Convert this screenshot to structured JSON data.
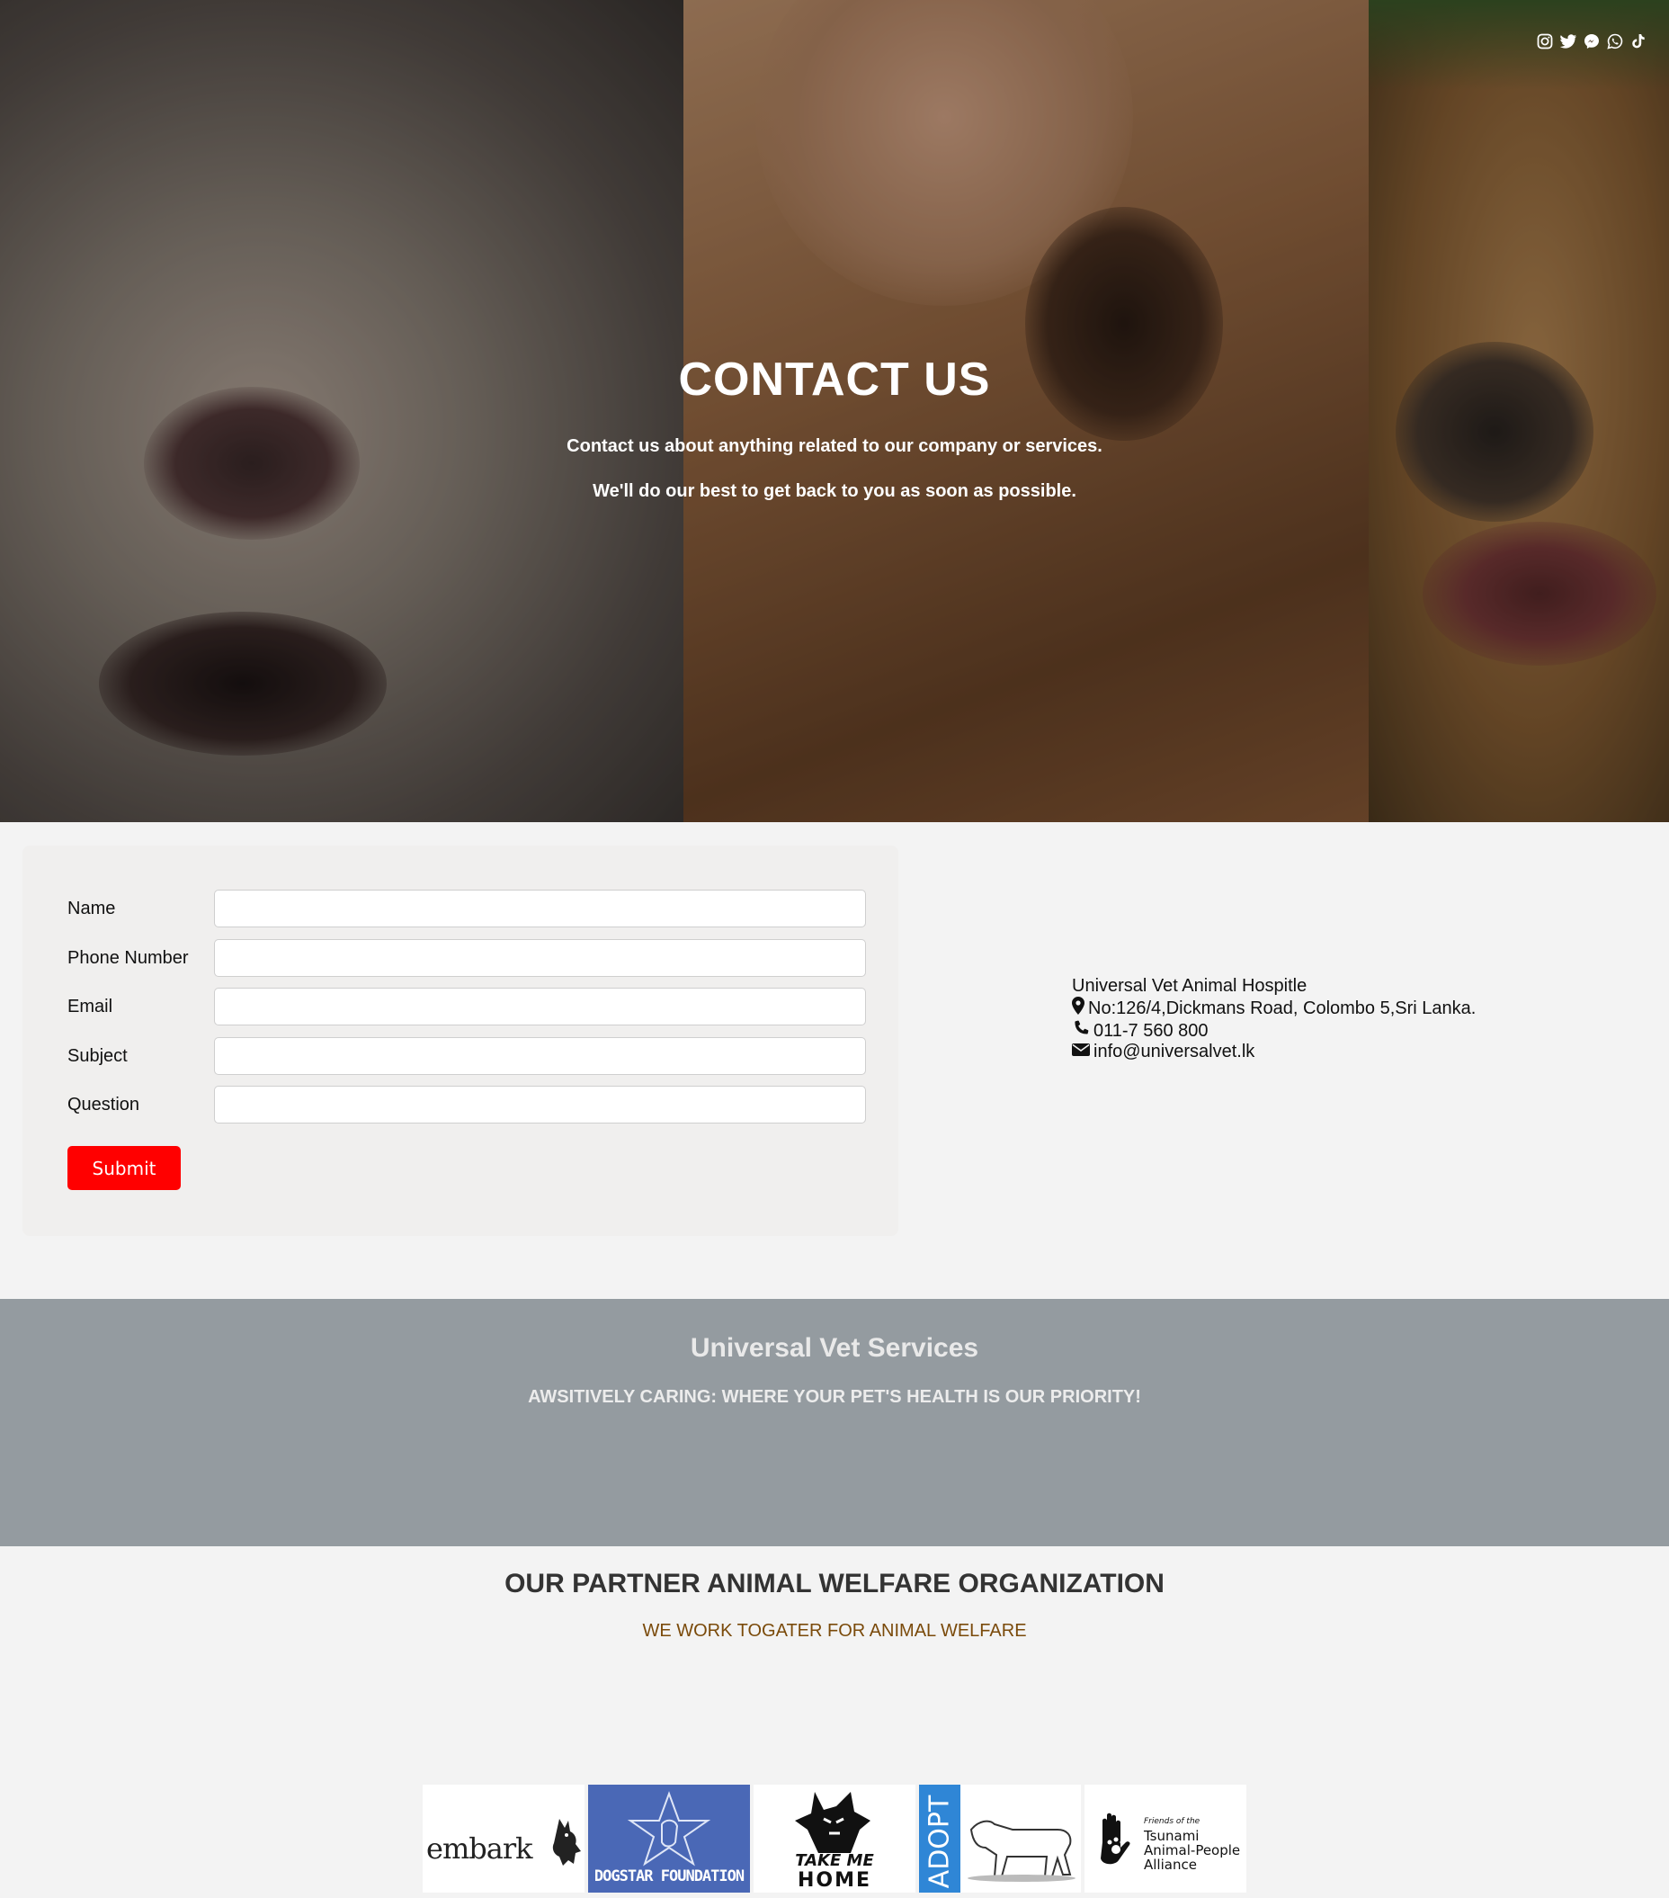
{
  "hero": {
    "title": "CONTACT US",
    "line1": "Contact us about anything related to our company or services.",
    "line2": "We'll do our best to get back to you as soon as possible.",
    "social_icons": [
      "instagram-icon",
      "twitter-icon",
      "messenger-icon",
      "whatsapp-icon",
      "tiktok-icon"
    ]
  },
  "form": {
    "fields": [
      {
        "label": "Name",
        "value": ""
      },
      {
        "label": "Phone Number",
        "value": ""
      },
      {
        "label": "Email",
        "value": ""
      },
      {
        "label": "Subject",
        "value": ""
      },
      {
        "label": "Question",
        "value": ""
      }
    ],
    "submit_label": "Submit",
    "submit_color": "#ff0000"
  },
  "contact": {
    "name": "Universal Vet Animal Hospitle",
    "address": "No:126/4,Dickmans Road, Colombo 5,Sri Lanka.",
    "phone": "011-7 560 800",
    "email": "info@universalvet.lk"
  },
  "services": {
    "title": "Universal Vet Services",
    "tagline": "AWSITIVELY CARING: WHERE YOUR PET'S HEALTH IS OUR PRIORITY!"
  },
  "partners": {
    "title": "OUR PARTNER ANIMAL WELFARE ORGANIZATION",
    "subtitle": "WE WORK TOGATER FOR ANIMAL WELFARE",
    "logos": {
      "embark": "embark",
      "dogstar": "DOGSTAR FOUNDATION",
      "takeme_1": "TAKE ME",
      "takeme_2": "HOME",
      "adopt": "ADOPT",
      "tapa_1": "Friends of the",
      "tapa_2": "Tsunami",
      "tapa_3": "Animal-People",
      "tapa_4": "Alliance"
    }
  },
  "colors": {
    "accent": "#ff0000",
    "band": "#949ba0",
    "subtitle": "#7a4a0a"
  }
}
